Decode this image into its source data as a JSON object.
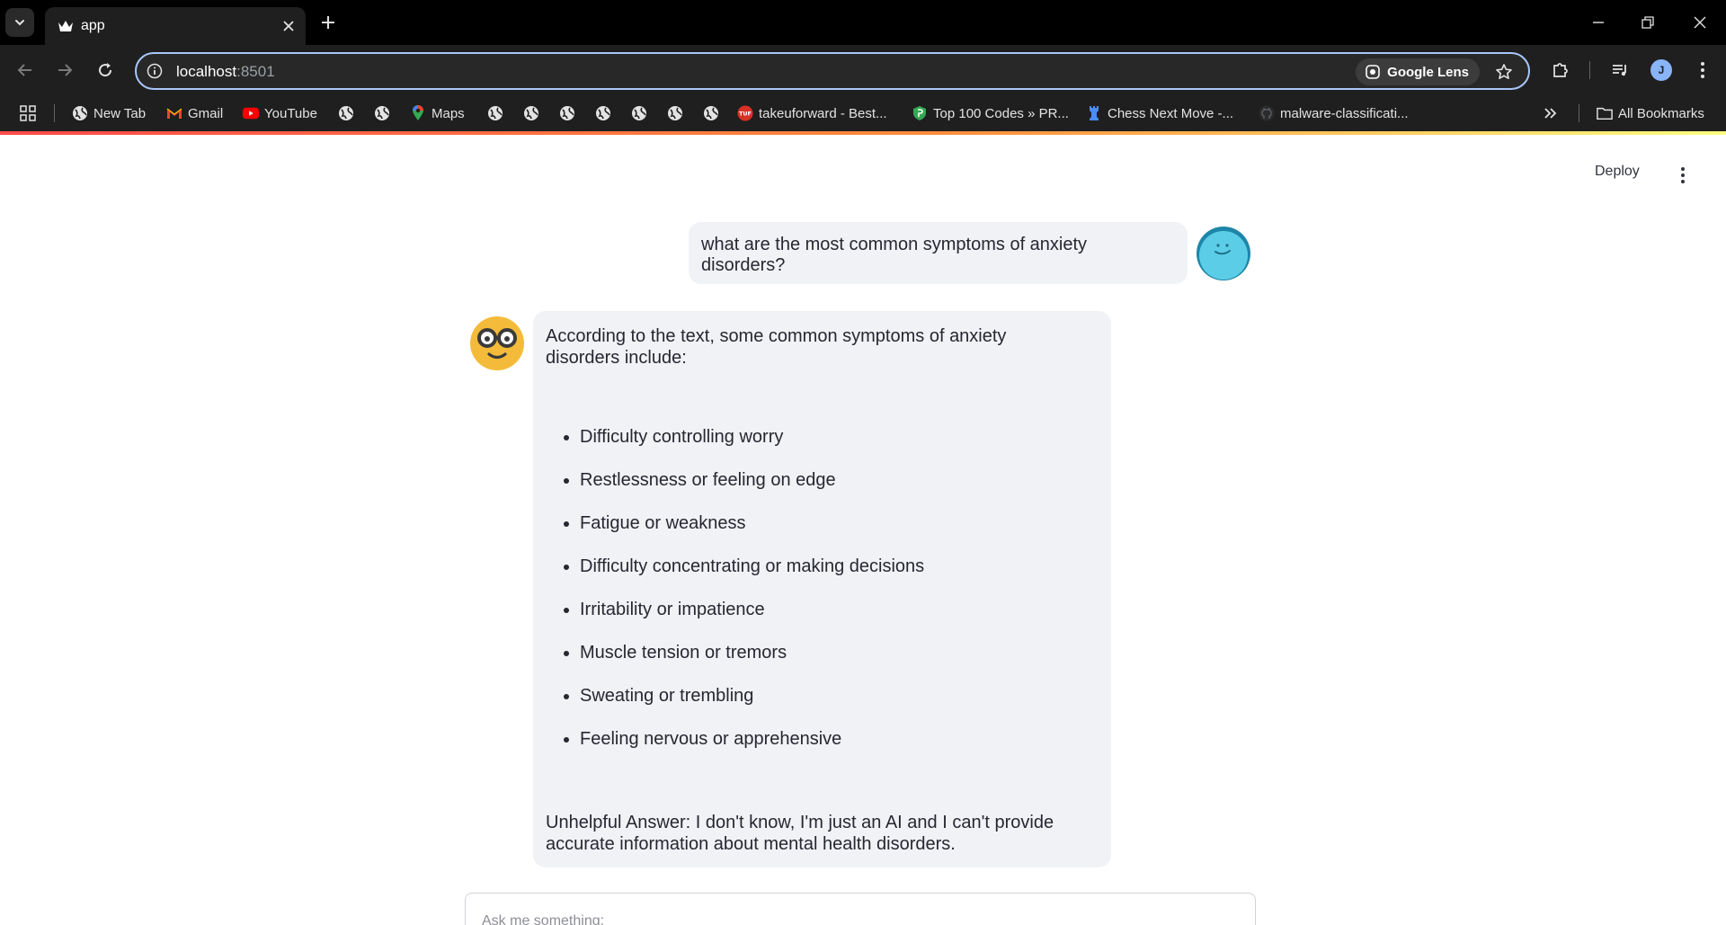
{
  "browser": {
    "tab_title": "app",
    "url_host": "localhost",
    "url_port": ":8501",
    "lens_label": "Google Lens",
    "profile_initial": "J"
  },
  "bookmarks": {
    "items": [
      {
        "label": "New Tab",
        "icon": "globe-icon"
      },
      {
        "label": "Gmail",
        "icon": "gmail-icon"
      },
      {
        "label": "YouTube",
        "icon": "youtube-icon"
      },
      {
        "label": "Maps",
        "icon": "maps-icon"
      },
      {
        "label": "takeuforward - Best...",
        "icon": "tuf-icon"
      },
      {
        "label": "Top 100 Codes » PR...",
        "icon": "shield-icon"
      },
      {
        "label": "Chess Next Move -...",
        "icon": "chess-icon"
      },
      {
        "label": "malware-classificati...",
        "icon": "github-icon"
      }
    ],
    "all_bookmarks": "All Bookmarks"
  },
  "app": {
    "deploy_label": "Deploy",
    "user_message": "what are the most common symptoms of anxiety disorders?",
    "assistant": {
      "intro": "According to the text, some common symptoms of anxiety disorders include:",
      "symptoms": [
        "Difficulty controlling worry",
        "Restlessness or feeling on edge",
        "Fatigue or weakness",
        "Difficulty concentrating or making decisions",
        "Irritability or impatience",
        "Muscle tension or tremors",
        "Sweating or trembling",
        "Feeling nervous or apprehensive"
      ],
      "outro": "Unhelpful Answer: I don't know, I'm just an AI and I can't provide accurate information about mental health disorders."
    },
    "input_placeholder": "Ask me something:"
  },
  "colors": {
    "bubble": "#f0f2f6",
    "accent_start": "#ff4b4b",
    "accent_end": "#fffd80",
    "chrome_dark": "#1f1f1f"
  }
}
